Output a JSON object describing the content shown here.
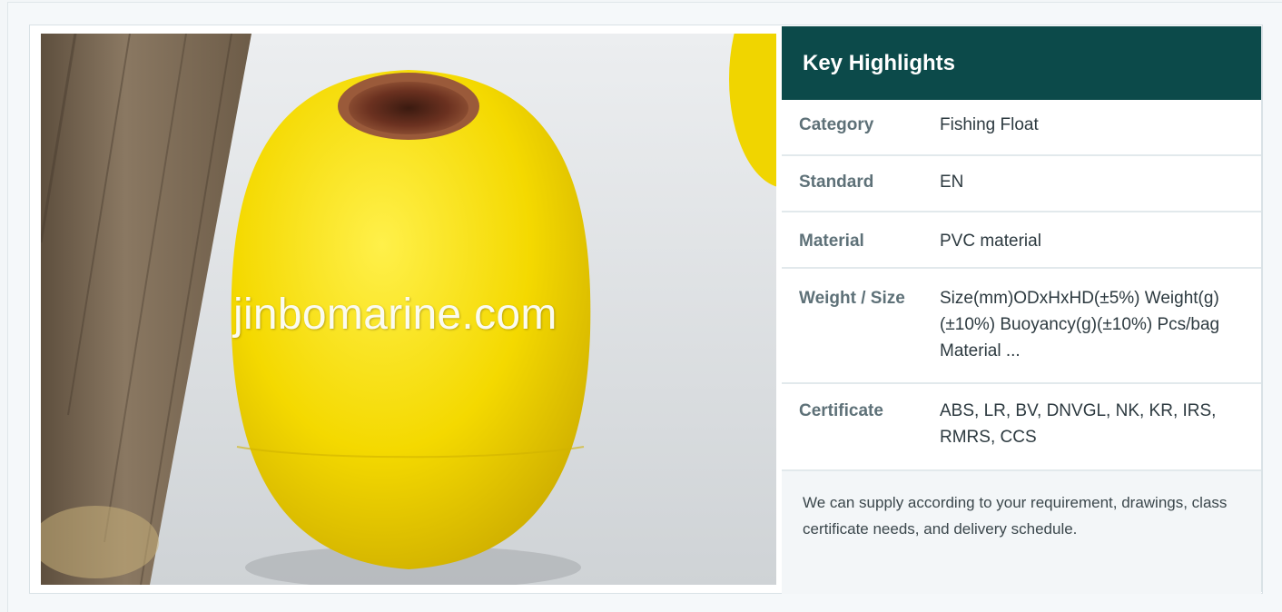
{
  "image": {
    "watermark": "jinbomarine.com",
    "colors": {
      "float_yellow": "#f2d800",
      "top_cap_brown": "#7a3a22",
      "floor_wood": "#7b6a55",
      "backdrop_white": "#dde0e3"
    }
  },
  "highlights": {
    "title": "Key Highlights",
    "header_color": "#0c4a4a",
    "rows": [
      {
        "label": "Category",
        "value": "Fishing Float"
      },
      {
        "label": "Standard",
        "value": "EN"
      },
      {
        "label": "Material",
        "value": "PVC material"
      },
      {
        "label": "Weight / Size",
        "value": "Size(mm)ODxHxHD(±5%) Weight(g)(±10%) Buoyancy(g)(±10%) Pcs/bag Material ..."
      },
      {
        "label": "Certificate",
        "value": "ABS, LR, BV, DNVGL, NK, KR, IRS, RMRS, CCS"
      }
    ],
    "note": "We can supply according to your requirement, drawings, class certificate needs, and delivery schedule."
  }
}
